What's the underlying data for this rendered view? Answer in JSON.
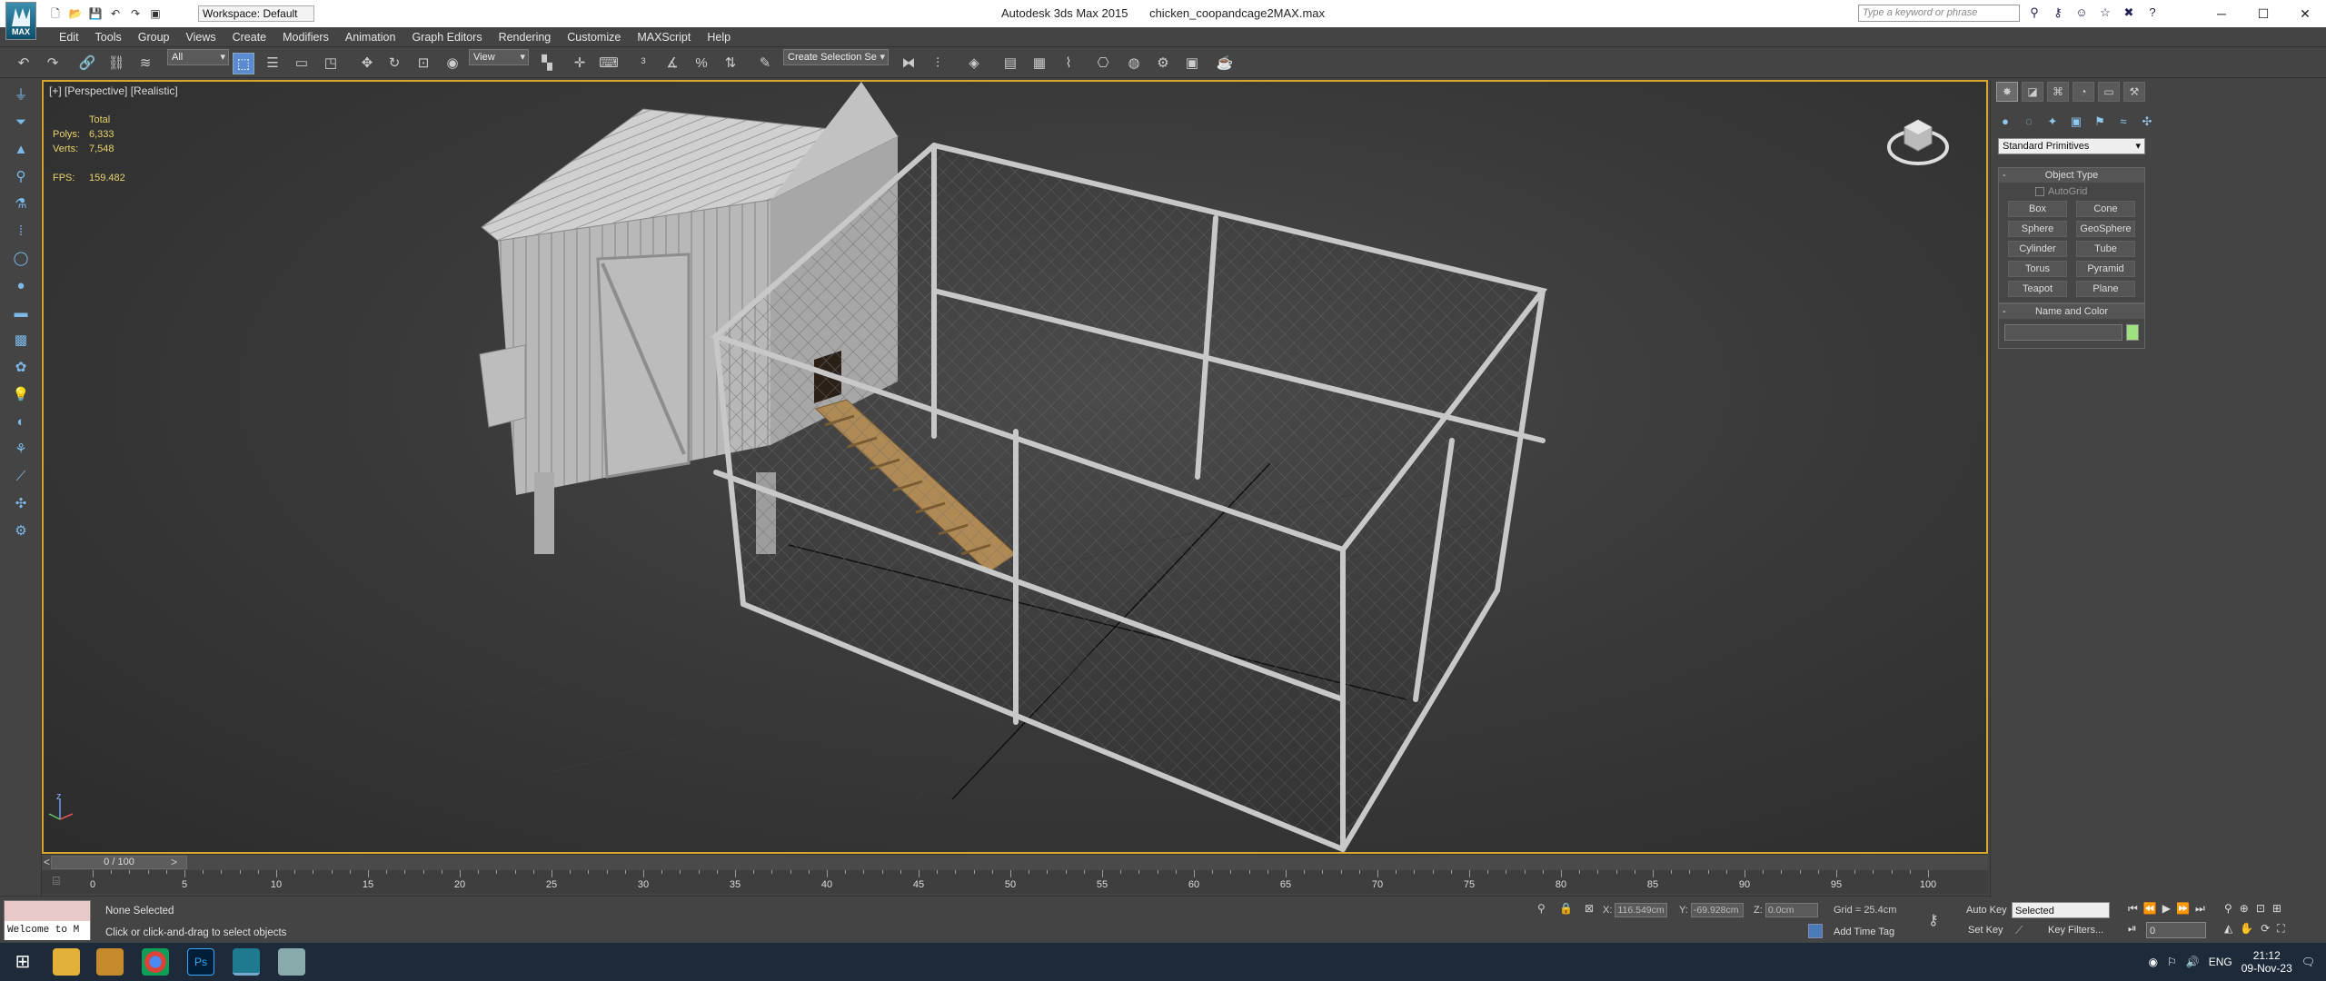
{
  "titlebar": {
    "app_name": "Autodesk 3ds Max  2015",
    "file_name": "chicken_coopandcage2MAX.max",
    "workspace": "Workspace: Default",
    "search_placeholder": "Type a keyword or phrase",
    "logo_text": "MAX",
    "min_icon": "minimize-icon",
    "max_icon": "maximize-icon",
    "close_icon": "close-icon"
  },
  "menu": [
    "Edit",
    "Tools",
    "Group",
    "Views",
    "Create",
    "Modifiers",
    "Animation",
    "Graph Editors",
    "Rendering",
    "Customize",
    "MAXScript",
    "Help"
  ],
  "toolbar": {
    "filter_value": "All",
    "refcoord_value": "View",
    "named_selection": "Create Selection Se"
  },
  "viewport": {
    "label": "[+] [Perspective] [Realistic]",
    "stats_header": "Total",
    "polys_label": "Polys:",
    "polys_value": "6,333",
    "verts_label": "Verts:",
    "verts_value": "7,548",
    "fps_label": "FPS:",
    "fps_value": "159.482",
    "axis_z": "z"
  },
  "timeline": {
    "slider_text": "0 / 100",
    "ticks": [
      "0",
      "5",
      "10",
      "15",
      "20",
      "25",
      "30",
      "35",
      "40",
      "45",
      "50",
      "55",
      "60",
      "65",
      "70",
      "75",
      "80",
      "85",
      "90",
      "95",
      "100"
    ],
    "prev_arrow": "<",
    "next_arrow": ">"
  },
  "status": {
    "welcome": "Welcome to M",
    "selection": "None Selected",
    "prompt": "Click or click-and-drag to select objects",
    "x_label": "X:",
    "x_value": "116.549cm",
    "y_label": "Y:",
    "y_value": "-69.928cm",
    "z_label": "Z:",
    "z_value": "0.0cm",
    "grid": "Grid = 25.4cm",
    "add_time_tag": "Add Time Tag",
    "auto_key": "Auto Key",
    "auto_key_sel": "Selected",
    "set_key": "Set Key",
    "key_filters": "Key Filters...",
    "frame": "0"
  },
  "cmdpanel": {
    "category": "Standard Primitives",
    "object_type_title": "Object Type",
    "autogrid": "AutoGrid",
    "buttons": [
      "Box",
      "Cone",
      "Sphere",
      "GeoSphere",
      "Cylinder",
      "Tube",
      "Torus",
      "Pyramid",
      "Teapot",
      "Plane"
    ],
    "name_color_title": "Name and Color"
  },
  "taskbar": {
    "lang": "ENG",
    "time": "21:12",
    "date": "09-Nov-23"
  }
}
